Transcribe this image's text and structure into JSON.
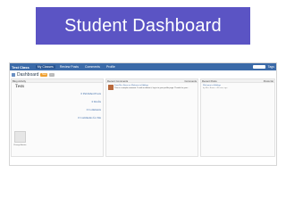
{
  "slide": {
    "title": "Student Dashboard"
  },
  "topbar": {
    "brand": "Test Class",
    "tabs": [
      "My Classes",
      "Review Posts",
      "Comments",
      "Profile"
    ],
    "help_label": "Tags"
  },
  "dashboard": {
    "title": "Dashboard",
    "pill_new": "New",
    "pill_other": "..."
  },
  "blog_activity": {
    "header": "Blog Activity",
    "blog_name": "Tests",
    "stats": [
      "0 Published Posts",
      "0 Drafts",
      "0 Comments",
      "0 Comments for Me"
    ],
    "avatar_caption": "Change Avatar"
  },
  "recent_comments": {
    "header": "Recent Comments",
    "header_right": "Comments",
    "comment": {
      "author": "From Mrs. Baum on Welcome to Edblogs",
      "text": "This is a sample comment. To edit or delete it, log in to your profile page. Thanks for your..."
    }
  },
  "recent_posts": {
    "header": "Recent Posts",
    "header_right": "Posts list",
    "post": {
      "title": "Welcome to Edblogs",
      "meta": "by Mrs. Baum - 48 mins ago"
    }
  }
}
